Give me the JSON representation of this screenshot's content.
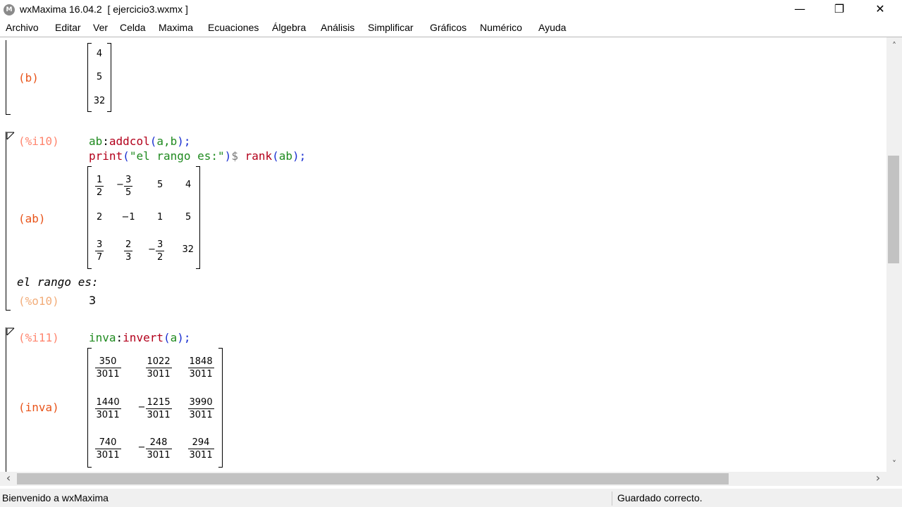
{
  "window": {
    "title": "wxMaxima 16.04.2  [ ejercicio3.wxmx ]",
    "icon_letter": "M",
    "controls": {
      "minimize": "—",
      "maximize": "❐",
      "close": "✕"
    }
  },
  "menubar": [
    "Archivo",
    "Editar",
    "Ver",
    "Celda",
    "Maxima",
    "Ecuaciones",
    "Álgebra",
    "Análisis",
    "Simplificar",
    "Gráficos",
    "Numérico",
    "Ayuda"
  ],
  "worksheet": {
    "cell_b": {
      "label": "(b)",
      "matrix": [
        "4",
        "5",
        "32"
      ]
    },
    "cell_i10": {
      "input_label": "(%i10)",
      "line1": {
        "var": "ab",
        "colon": ":",
        "fn": "addcol",
        "open": "(",
        "args": "a,b",
        "close": ");"
      },
      "line2": {
        "fn": "print",
        "open": "(",
        "str": "\"el rango es:\"",
        "close": ")",
        "dollar": "$",
        "fn2": "rank",
        "open2": "(",
        "arg2": "ab",
        "close2": ");"
      },
      "output_label": "(ab)",
      "matrix": [
        [
          "1/2",
          "-3/5",
          "5",
          "4"
        ],
        [
          "2",
          "-1",
          "1",
          "5"
        ],
        [
          "3/7",
          "2/3",
          "-3/2",
          "32"
        ]
      ],
      "printed": "el rango es:",
      "result_label": "(%o10)",
      "result": "3"
    },
    "cell_i11": {
      "input_label": "(%i11)",
      "line1": {
        "var": "inva",
        "colon": ":",
        "fn": "invert",
        "open": "(",
        "args": "a",
        "close": ");"
      },
      "output_label": "(inva)",
      "matrix": [
        [
          "350/3011",
          "1022/3011",
          "1848/3011"
        ],
        [
          "1440/3011",
          "-1215/3011",
          "3990/3011"
        ],
        [
          "740/3011",
          "-248/3011",
          "294/3011"
        ]
      ]
    }
  },
  "statusbar": {
    "left": "Bienvenido a wxMaxima",
    "right": "Guardado correcto."
  },
  "scroll_arrows": {
    "up": "˄",
    "down": "˅",
    "left": "‹",
    "right": "›"
  }
}
